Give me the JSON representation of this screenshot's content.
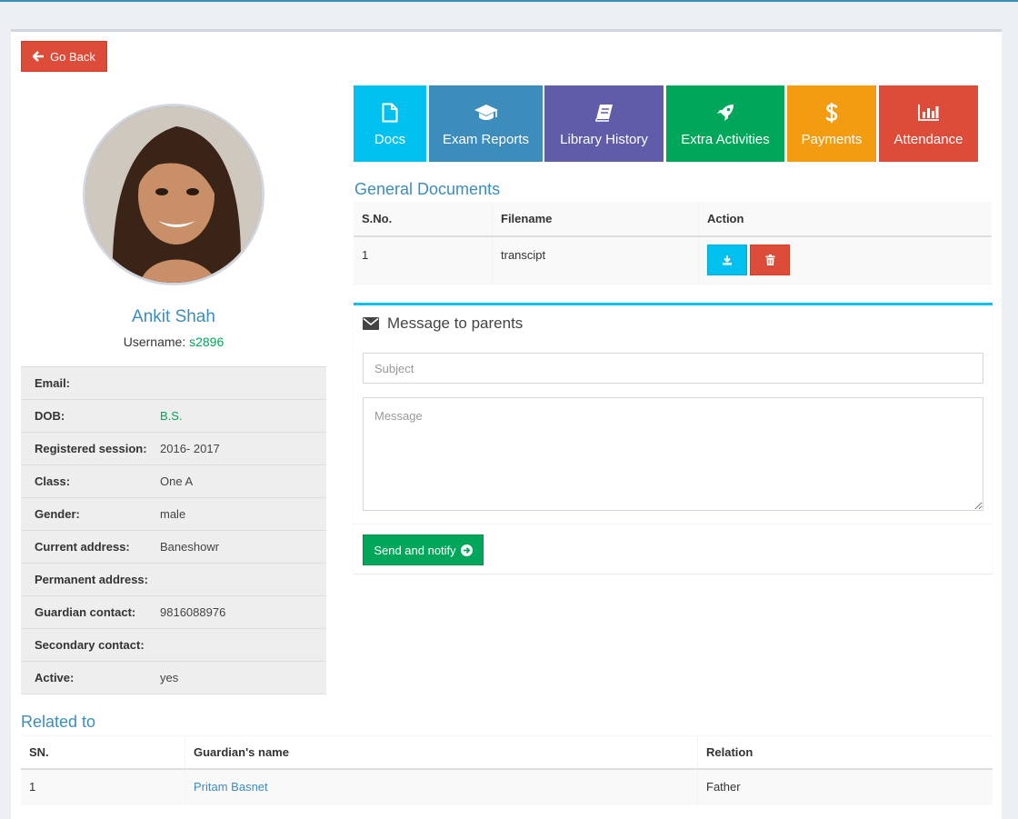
{
  "nav": {
    "back_label": "Go Back"
  },
  "profile": {
    "name": "Ankit Shah",
    "username_label": "Username:",
    "username": "s2896",
    "fields": [
      {
        "label": "Email:",
        "value": ""
      },
      {
        "label": "DOB:",
        "value": "B.S."
      },
      {
        "label": "Registered session:",
        "value": "2016- 2017"
      },
      {
        "label": "Class:",
        "value": "One A"
      },
      {
        "label": "Gender:",
        "value": "male"
      },
      {
        "label": "Current address:",
        "value": "Baneshowr"
      },
      {
        "label": "Permanent address:",
        "value": ""
      },
      {
        "label": "Guardian contact:",
        "value": "9816088976"
      },
      {
        "label": "Secondary contact:",
        "value": ""
      },
      {
        "label": "Active:",
        "value": "yes"
      }
    ]
  },
  "tiles": [
    {
      "label": "Docs",
      "icon": "file-icon",
      "color": "#00c0ef"
    },
    {
      "label": "Exam Reports",
      "icon": "graduation-cap-icon",
      "color": "#3c8dbc"
    },
    {
      "label": "Library History",
      "icon": "book-icon",
      "color": "#605ca8"
    },
    {
      "label": "Extra Activities",
      "icon": "rocket-icon",
      "color": "#00a65a"
    },
    {
      "label": "Payments",
      "icon": "dollar-icon",
      "color": "#f39c12"
    },
    {
      "label": "Attendance",
      "icon": "bar-chart-icon",
      "color": "#dd4b39"
    }
  ],
  "documents": {
    "title": "General Documents",
    "headers": [
      "S.No.",
      "Filename",
      "Action"
    ],
    "rows": [
      {
        "sn": "1",
        "filename": "transcipt"
      }
    ]
  },
  "message": {
    "title": "Message to parents",
    "subject_placeholder": "Subject",
    "message_placeholder": "Message",
    "send_label": "Send and notify"
  },
  "related": {
    "title": "Related to",
    "headers": [
      "SN.",
      "Guardian's name",
      "Relation"
    ],
    "rows": [
      {
        "sn": "1",
        "name": "Pritam Basnet",
        "relation": "Father"
      }
    ]
  }
}
